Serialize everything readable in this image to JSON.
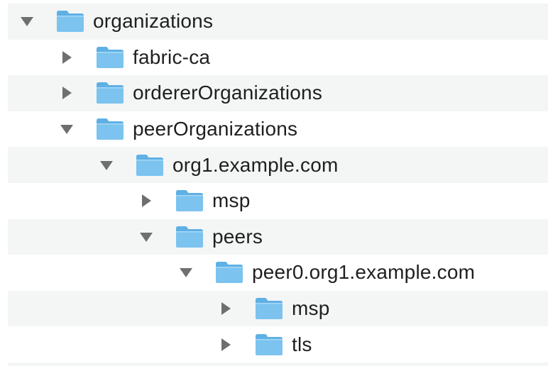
{
  "tree": {
    "rows": [
      {
        "label": "organizations",
        "depth": 0,
        "expanded": true,
        "icon": "folder-icon"
      },
      {
        "label": "fabric-ca",
        "depth": 1,
        "expanded": false,
        "icon": "folder-icon"
      },
      {
        "label": "ordererOrganizations",
        "depth": 1,
        "expanded": false,
        "icon": "folder-icon"
      },
      {
        "label": "peerOrganizations",
        "depth": 1,
        "expanded": true,
        "icon": "folder-icon"
      },
      {
        "label": "org1.example.com",
        "depth": 2,
        "expanded": true,
        "icon": "folder-icon"
      },
      {
        "label": "msp",
        "depth": 3,
        "expanded": false,
        "icon": "folder-icon"
      },
      {
        "label": "peers",
        "depth": 3,
        "expanded": true,
        "icon": "folder-icon"
      },
      {
        "label": "peer0.org1.example.com",
        "depth": 4,
        "expanded": true,
        "icon": "folder-icon"
      },
      {
        "label": "msp",
        "depth": 5,
        "expanded": false,
        "icon": "folder-icon"
      },
      {
        "label": "tls",
        "depth": 5,
        "expanded": false,
        "icon": "folder-icon"
      }
    ]
  },
  "colors": {
    "stripe": "#f4f5f5",
    "folder_body": "#7cc3ef",
    "folder_tab": "#5eb0e5",
    "disclosure": "#6f6f6f",
    "text": "#1f1f1f"
  }
}
